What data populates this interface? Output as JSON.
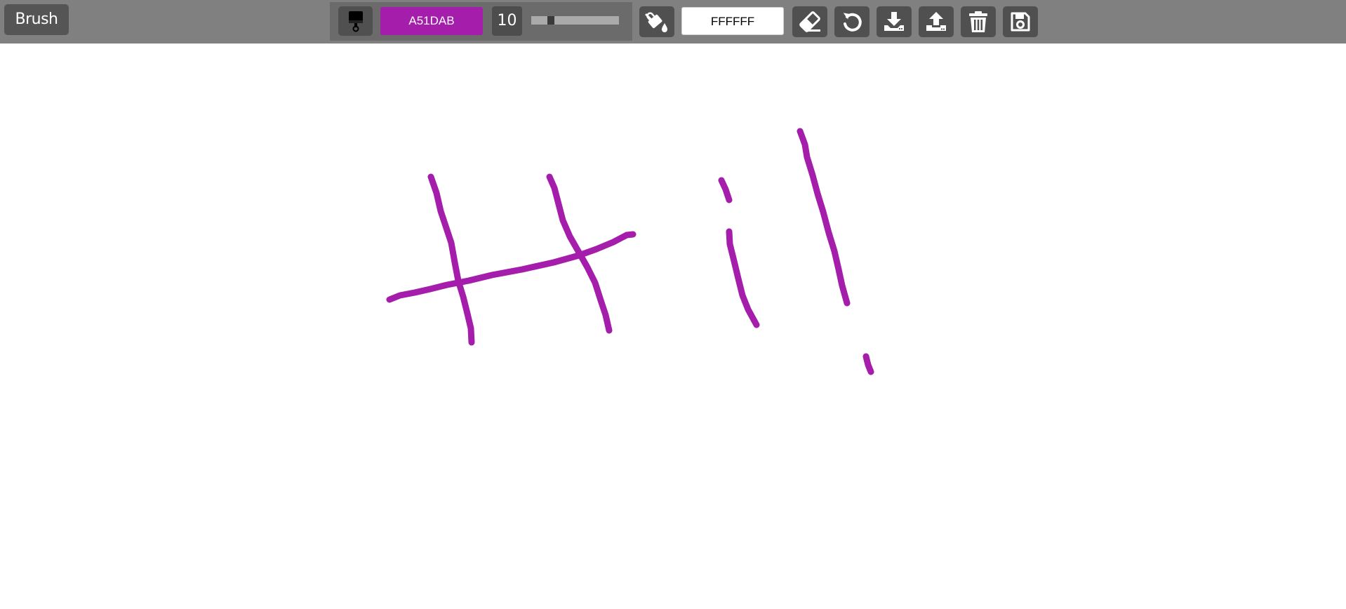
{
  "toolbar": {
    "mode_label": "Brush",
    "brush_color_hex": "A51DAB",
    "brush_size": "10",
    "brush_size_fraction": 0.2,
    "background_color_hex": "FFFFFF"
  },
  "icons": {
    "brush_tool": "paint-brush-icon",
    "fill": "paint-bucket-icon",
    "eraser": "eraser-icon",
    "undo": "undo-icon",
    "download": "download-icon",
    "upload": "upload-icon",
    "clear": "trash-icon",
    "save": "save-icon"
  },
  "colors": {
    "toolbar": "#808080",
    "button": "#505050",
    "stroke": "#A51DAB",
    "canvas": "#FFFFFF"
  }
}
